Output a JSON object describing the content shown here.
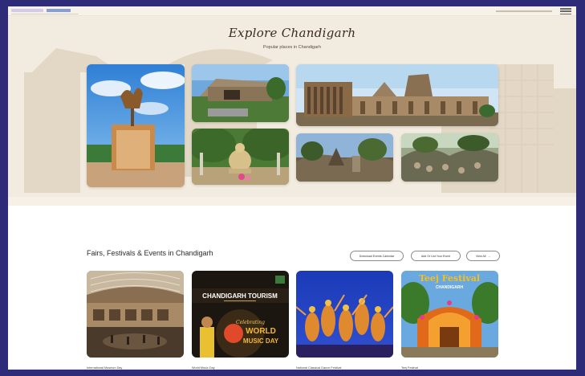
{
  "header": {
    "logo_name": "chandigarh-tourism-logo",
    "menu_icon": "hamburger-menu-icon"
  },
  "hero": {
    "title": "Explore Chandigarh",
    "subtitle": "Popular places in Chandigarh",
    "photos": [
      {
        "name": "open-hand-monument-photo"
      },
      {
        "name": "government-museum-photo"
      },
      {
        "name": "capitol-complex-photo"
      },
      {
        "name": "buddha-statue-garden-photo"
      },
      {
        "name": "rock-garden-photo"
      },
      {
        "name": "rock-garden-sculptures-photo"
      }
    ]
  },
  "events": {
    "section_title": "Fairs, Festivals & Events in Chandigarh",
    "buttons": {
      "download_calendar": "Download Events Calendar",
      "add_event": "Add Or List Your Event",
      "view_all": "View All"
    },
    "cards": [
      {
        "caption": "International Museum Day"
      },
      {
        "caption": "World Music Day",
        "title": "CHANDIGARH TOURISM",
        "script": "Celebrating",
        "headline": "WORLD MUSIC DAY"
      },
      {
        "caption": "National Classical Dance Festival"
      },
      {
        "caption": "Teej Festival",
        "banner": "Teej Festival",
        "subbanner": "CHANDIGARH"
      }
    ]
  }
}
